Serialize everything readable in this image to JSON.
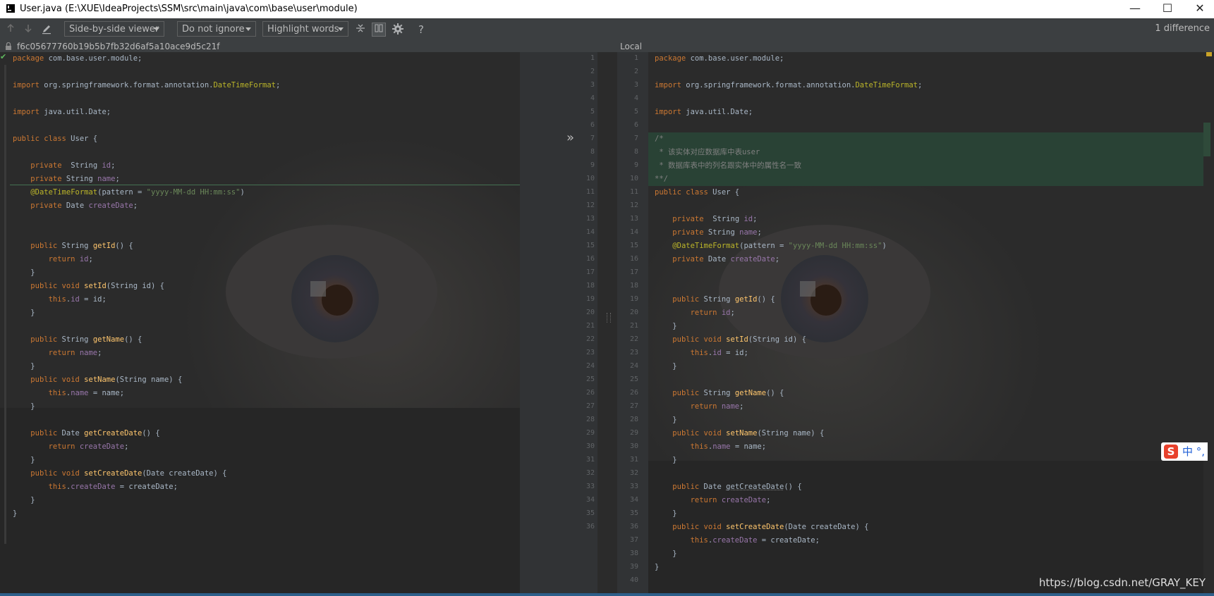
{
  "window": {
    "title": "User.java (E:\\XUE\\IdeaProjects\\SSM\\src\\main\\java\\com\\base\\user\\module)",
    "minimize": "—",
    "maximize": "☐",
    "close": "✕"
  },
  "toolbar": {
    "viewer": "Side-by-side viewer",
    "ignore": "Do not ignore",
    "highlight": "Highlight words",
    "help": "?",
    "difference_count": "1 difference"
  },
  "left_panel": {
    "revision": "f6c05677760b19b5b7fb32d6af5a10ace9d5c21f"
  },
  "right_panel": {
    "label": "Local"
  },
  "left_lines": [
    "1",
    "2",
    "3",
    "4",
    "5",
    "6",
    "7",
    "8",
    "9",
    "10",
    "11",
    "12",
    "13",
    "14",
    "15",
    "16",
    "17",
    "18",
    "19",
    "20",
    "21",
    "22",
    "23",
    "24",
    "25",
    "26",
    "27",
    "28",
    "29",
    "30",
    "31",
    "32",
    "33",
    "34",
    "35",
    "36"
  ],
  "right_lines": [
    "1",
    "2",
    "3",
    "4",
    "5",
    "6",
    "7",
    "8",
    "9",
    "10",
    "11",
    "12",
    "13",
    "14",
    "15",
    "16",
    "17",
    "18",
    "19",
    "20",
    "21",
    "22",
    "23",
    "24",
    "25",
    "26",
    "27",
    "28",
    "29",
    "30",
    "31",
    "32",
    "33",
    "34",
    "35",
    "36",
    "37",
    "38",
    "39",
    "40"
  ],
  "left_code": [
    "package com.base.user.module;",
    "",
    "import org.springframework.format.annotation.DateTimeFormat;",
    "",
    "import java.util.Date;",
    "",
    "public class User {",
    "",
    "    private  String id;",
    "    private String name;",
    "    @DateTimeFormat(pattern = \"yyyy-MM-dd HH:mm:ss\")",
    "    private Date createDate;",
    "",
    "",
    "    public String getId() {",
    "        return id;",
    "    }",
    "    public void setId(String id) {",
    "        this.id = id;",
    "    }",
    "",
    "    public String getName() {",
    "        return name;",
    "    }",
    "    public void setName(String name) {",
    "        this.name = name;",
    "    }",
    "",
    "    public Date getCreateDate() {",
    "        return createDate;",
    "    }",
    "    public void setCreateDate(Date createDate) {",
    "        this.createDate = createDate;",
    "    }",
    "}",
    ""
  ],
  "right_code": [
    "package com.base.user.module;",
    "",
    "import org.springframework.format.annotation.DateTimeFormat;",
    "",
    "import java.util.Date;",
    "",
    "/*",
    " * 该实体对应数据库中表user",
    " * 数据库表中的列名跟实体中的属性名一致",
    "**/",
    "public class User {",
    "",
    "    private  String id;",
    "    private String name;",
    "    @DateTimeFormat(pattern = \"yyyy-MM-dd HH:mm:ss\")",
    "    private Date createDate;",
    "",
    "",
    "    public String getId() {",
    "        return id;",
    "    }",
    "    public void setId(String id) {",
    "        this.id = id;",
    "    }",
    "",
    "    public String getName() {",
    "        return name;",
    "    }",
    "    public void setName(String name) {",
    "        this.name = name;",
    "    }",
    "",
    "    public Date getCreateDate() {",
    "        return createDate;",
    "    }",
    "    public void setCreateDate(Date createDate) {",
    "        this.createDate = createDate;",
    "    }",
    "}",
    ""
  ],
  "colors": {
    "keyword": "#cc7832",
    "annotation": "#bbb529",
    "string": "#6a8759",
    "field": "#9876aa",
    "method": "#ffc66d",
    "comment": "#808080",
    "diff_added": "#294436"
  },
  "watermark": "https://blog.csdn.net/GRAY_KEY",
  "ime": {
    "logo": "S",
    "text": "中 °,"
  }
}
